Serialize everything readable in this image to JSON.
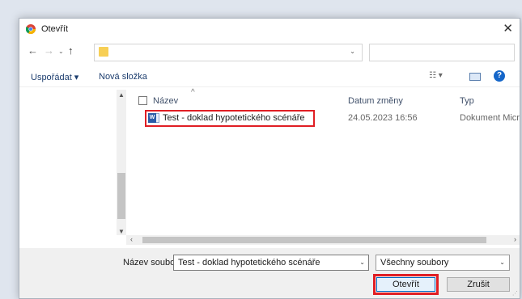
{
  "window": {
    "title": "Otevřít",
    "close_label": "✕"
  },
  "nav": {
    "back": "←",
    "forward": "→",
    "recent": "⌄",
    "up": "↑",
    "address_dropdown": "⌄",
    "refresh": "↻"
  },
  "toolbar": {
    "organize_label": "Uspořádat ▾",
    "new_folder_label": "Nová složka",
    "view_label": "☷ ▾",
    "help_label": "?"
  },
  "columns": {
    "name": "Název",
    "date": "Datum změny",
    "type": "Typ"
  },
  "file": {
    "icon_label": "W",
    "name": "Test - doklad hypotetického scénáře",
    "date": "24.05.2023 16:56",
    "type": "Dokument Micr"
  },
  "bottom": {
    "filename_label": "Název souboru:",
    "filename_value": "Test - doklad hypotetického scénáře",
    "filetype_value": "Všechny soubory",
    "open_label": "Otevřít",
    "cancel_label": "Zrušit"
  },
  "colors": {
    "highlight": "#e01e24",
    "accent": "#0067c0"
  }
}
